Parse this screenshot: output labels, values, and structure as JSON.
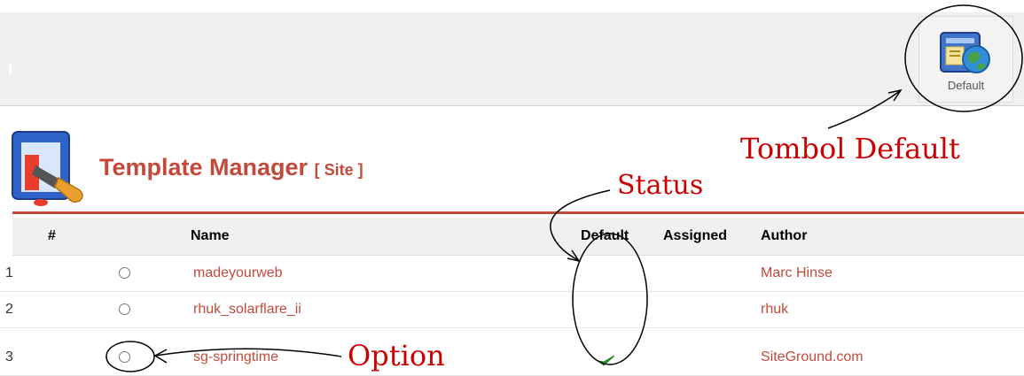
{
  "toolbar": {
    "default_button_label": "Default"
  },
  "header": {
    "title": "Template Manager",
    "scope": "[ Site ]"
  },
  "table": {
    "columns": {
      "num": "#",
      "name": "Name",
      "default": "Default",
      "assigned": "Assigned",
      "author": "Author"
    },
    "rows": [
      {
        "num": "1",
        "name": "madeyourweb",
        "author": "Marc Hinse",
        "is_default": false
      },
      {
        "num": "2",
        "name": "rhuk_solarflare_ii",
        "author": "rhuk",
        "is_default": false
      },
      {
        "num": "3",
        "name": "sg-springtime",
        "author": "SiteGround.com",
        "is_default": true
      }
    ]
  },
  "annotations": {
    "default_button_note": "Tombol Default",
    "status_note": "Status",
    "option_note": "Option"
  },
  "colors": {
    "accent": "#c34a3b",
    "annotation": "#cc0000",
    "check": "#2a9d2a"
  },
  "icons": {
    "default_button": "default-template-icon",
    "header": "template-manager-icon",
    "status": "check-icon"
  }
}
